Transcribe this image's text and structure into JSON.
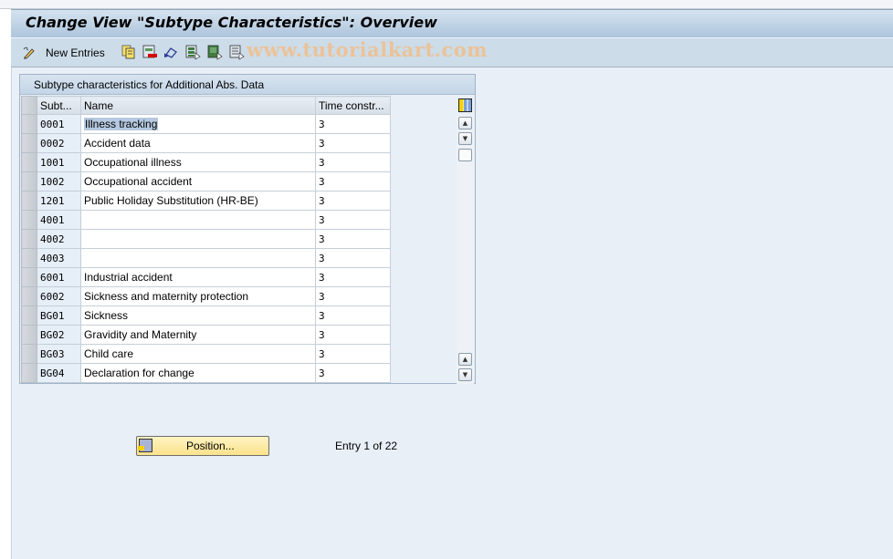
{
  "window": {
    "title": "Change View \"Subtype Characteristics\": Overview"
  },
  "toolbar": {
    "new_entries_label": "New Entries",
    "icons": [
      "edit-pencil-icon",
      "copy-as-icon",
      "delete-icon",
      "undo-change-icon",
      "select-all-icon",
      "select-block-icon",
      "deselect-all-icon"
    ],
    "watermark": "www.tutorialkart.com"
  },
  "table": {
    "title": "Subtype characteristics for Additional Abs. Data",
    "columns": [
      "Subt...",
      "Name",
      "Time constr..."
    ],
    "rows": [
      {
        "code": "0001",
        "name": "Illness tracking",
        "time": "3",
        "selected_text": true
      },
      {
        "code": "0002",
        "name": "Accident data",
        "time": "3"
      },
      {
        "code": "1001",
        "name": "Occupational illness",
        "time": "3"
      },
      {
        "code": "1002",
        "name": "Occupational accident",
        "time": "3"
      },
      {
        "code": "1201",
        "name": "Public Holiday Substitution (HR-BE)",
        "time": "3"
      },
      {
        "code": "4001",
        "name": "",
        "time": "3"
      },
      {
        "code": "4002",
        "name": "",
        "time": "3"
      },
      {
        "code": "4003",
        "name": "",
        "time": "3"
      },
      {
        "code": "6001",
        "name": "Industrial accident",
        "time": "3"
      },
      {
        "code": "6002",
        "name": "Sickness and maternity protection",
        "time": "3"
      },
      {
        "code": "BG01",
        "name": "Sickness",
        "time": "3"
      },
      {
        "code": "BG02",
        "name": "Gravidity and Maternity",
        "time": "3"
      },
      {
        "code": "BG03",
        "name": "Child care",
        "time": "3"
      },
      {
        "code": "BG04",
        "name": "Declaration for change",
        "time": "3"
      }
    ]
  },
  "footer": {
    "position_button_label": "Position...",
    "entry_info": "Entry 1 of 22"
  }
}
